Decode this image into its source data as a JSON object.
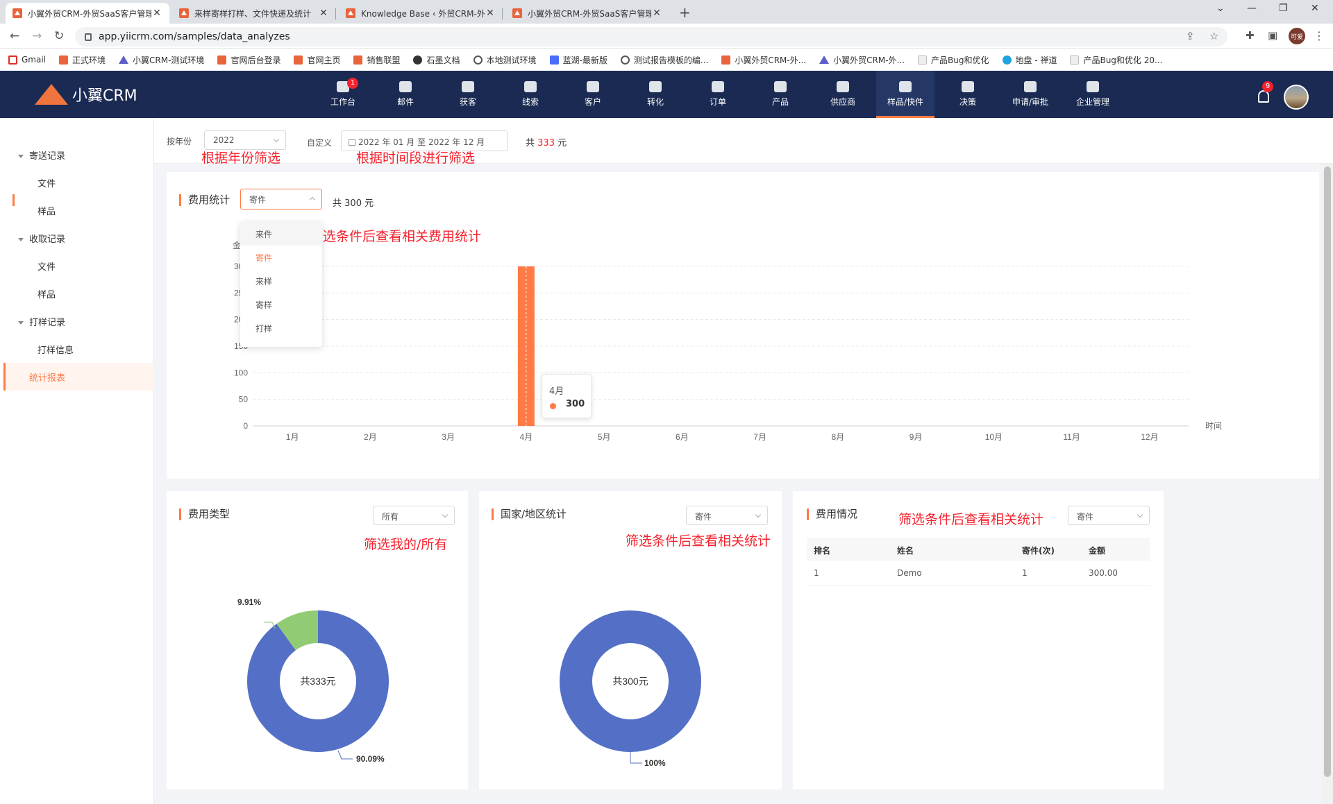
{
  "browser": {
    "tabs": [
      {
        "title": "小翼外贸CRM-外贸SaaS客户管理",
        "active": true
      },
      {
        "title": "来样寄样打样、文件快递及统计",
        "active": false
      },
      {
        "title": "Knowledge Base ‹ 外贸CRM-外",
        "active": false
      },
      {
        "title": "小翼外贸CRM-外贸SaaS客户管理",
        "active": false
      }
    ],
    "url": "app.yiicrm.com/samples/data_analyzes",
    "profile_label": "可爱",
    "bookmarks": [
      "Gmail",
      "正式环境",
      "小翼CRM-测试环境",
      "官网后台登录",
      "官网主页",
      "销售联盟",
      "石墨文档",
      "本地测试环境",
      "蓝湖-最新版",
      "测试报告模板的编...",
      "小翼外贸CRM-外...",
      "小翼外贸CRM-外...",
      "产品Bug和优化",
      "地盘 - 禅道",
      "产品Bug和优化 20..."
    ]
  },
  "app": {
    "logo_text": "小翼CRM",
    "nav": [
      {
        "label": "工作台",
        "badge": "1"
      },
      {
        "label": "邮件"
      },
      {
        "label": "获客"
      },
      {
        "label": "线索"
      },
      {
        "label": "客户"
      },
      {
        "label": "转化"
      },
      {
        "label": "订单"
      },
      {
        "label": "产品"
      },
      {
        "label": "供应商"
      },
      {
        "label": "样品/快件",
        "active": true
      },
      {
        "label": "决策"
      },
      {
        "label": "申请/审批"
      },
      {
        "label": "企业管理"
      }
    ],
    "notification_count": "9",
    "accent_color": "#ff7a45",
    "header_color": "#1a2a52"
  },
  "sidebar": {
    "groups": [
      {
        "label": "寄送记录",
        "items": [
          "文件",
          "样品"
        ]
      },
      {
        "label": "收取记录",
        "items": [
          "文件",
          "样品"
        ]
      },
      {
        "label": "打样记录",
        "items": [
          "打样信息"
        ]
      }
    ],
    "active_item": "统计报表"
  },
  "filter": {
    "year_label": "按年份",
    "year_value": "2022",
    "custom_label": "自定义",
    "date_start": "2022 年 01 月",
    "date_sep": "至",
    "date_end": "2022 年 12 月",
    "total_prefix": "共",
    "total_value": "333",
    "total_unit": "元"
  },
  "annotations": {
    "year": "根据年份筛选",
    "period": "根据时间段进行筛选",
    "cost_stats": "筛选条件后查看相关费用统计",
    "mine_all": "筛选我的/所有",
    "country": "筛选条件后查看相关统计",
    "cost_detail": "筛选条件后查看相关统计"
  },
  "cost_stats": {
    "title": "费用统计",
    "select_value": "寄件",
    "total_prefix": "共",
    "total_value": "300",
    "total_unit": "元",
    "dropdown_options": [
      "来件",
      "寄件",
      "来样",
      "寄样",
      "打样"
    ],
    "selected_option": "寄件",
    "tooltip_month": "4月",
    "tooltip_value": "300"
  },
  "cost_type": {
    "title": "费用类型",
    "select_value": "所有",
    "center_text": "共333元"
  },
  "country": {
    "title": "国家/地区统计",
    "select_value": "寄件",
    "center_text": "共300元"
  },
  "cost_detail": {
    "title": "费用情况",
    "select_value": "寄件",
    "columns": [
      "排名",
      "姓名",
      "寄件(次)",
      "金额"
    ],
    "rows": [
      [
        "1",
        "Demo",
        "1",
        "300.00"
      ]
    ]
  },
  "chart_data": [
    {
      "type": "bar",
      "ylabel": "金",
      "xlabel": "时间",
      "categories": [
        "1月",
        "2月",
        "3月",
        "4月",
        "5月",
        "6月",
        "7月",
        "8月",
        "9月",
        "10月",
        "11月",
        "12月"
      ],
      "values": [
        0,
        0,
        0,
        300,
        0,
        0,
        0,
        0,
        0,
        0,
        0,
        0
      ],
      "yticks": [
        0,
        50,
        100,
        150,
        200,
        250,
        300
      ],
      "ylim": [
        0,
        300
      ],
      "grid": true,
      "color": "#ff7a45"
    },
    {
      "type": "pie",
      "labels": [
        "90.09%",
        "9.91%"
      ],
      "values": [
        90.09,
        9.91
      ],
      "colors": [
        "#5470c6",
        "#91cc75"
      ]
    },
    {
      "type": "pie",
      "labels": [
        "100%"
      ],
      "values": [
        100
      ],
      "colors": [
        "#5470c6"
      ]
    }
  ]
}
